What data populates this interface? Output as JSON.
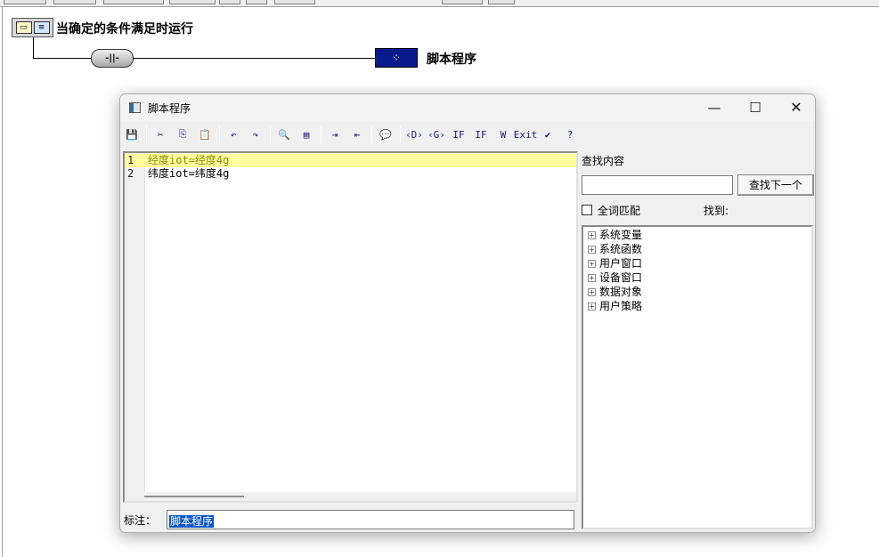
{
  "diagram": {
    "condition_label": "当确定的条件满足时运行",
    "switch_symbol": "-||-",
    "script_node_symbol": "⁘",
    "script_label": "脚本程序"
  },
  "dialog": {
    "title": "脚本程序",
    "window_buttons": {
      "minimize": "—",
      "maximize": "☐",
      "close": "✕"
    },
    "toolbar": [
      {
        "name": "save-icon",
        "glyph": "💾"
      },
      {
        "name": "cut-icon",
        "glyph": "✂"
      },
      {
        "name": "copy-icon",
        "glyph": "⎘"
      },
      {
        "name": "paste-icon",
        "glyph": "📋"
      },
      {
        "name": "undo-icon",
        "glyph": "↶"
      },
      {
        "name": "redo-icon",
        "glyph": "↷"
      },
      {
        "name": "find-icon",
        "glyph": "🔍"
      },
      {
        "name": "document-icon",
        "glyph": "▤"
      },
      {
        "name": "import-icon",
        "glyph": "⇥"
      },
      {
        "name": "export-icon",
        "glyph": "⇤"
      },
      {
        "name": "comment-icon",
        "glyph": "💬"
      },
      {
        "name": "insert-d-icon",
        "glyph": "‹D›"
      },
      {
        "name": "insert-g-icon",
        "glyph": "‹G›"
      },
      {
        "name": "if-icon",
        "glyph": "IF"
      },
      {
        "name": "if-else-icon",
        "glyph": "IF"
      },
      {
        "name": "while-icon",
        "glyph": "W"
      },
      {
        "name": "exit-icon",
        "glyph": "Exit"
      },
      {
        "name": "check-syntax-icon",
        "glyph": "✔"
      },
      {
        "name": "help-icon",
        "glyph": "?"
      }
    ],
    "editor": {
      "lines": [
        {
          "num": "1",
          "text": "经度iot=经度4g"
        },
        {
          "num": "2",
          "text": "纬度iot=纬度4g"
        }
      ]
    },
    "note": {
      "label": "标注：",
      "value": "脚本程序"
    },
    "find": {
      "label": "查找内容",
      "input_value": "",
      "next_button": "查找下一个",
      "whole_word_label": "全词匹配",
      "found_label": "找到:"
    },
    "tree": [
      {
        "label": "系统变量"
      },
      {
        "label": "系统函数"
      },
      {
        "label": "用户窗口"
      },
      {
        "label": "设备窗口"
      },
      {
        "label": "数据对象"
      },
      {
        "label": "用户策略"
      }
    ]
  }
}
